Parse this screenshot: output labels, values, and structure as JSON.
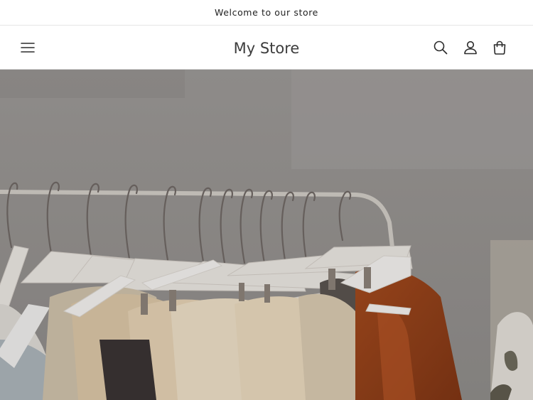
{
  "announcement": {
    "text": "Welcome to our store"
  },
  "header": {
    "logo": "My Store",
    "icons": {
      "menu": "hamburger-menu-icon",
      "search": "search-icon",
      "account": "account-icon",
      "cart": "cart-icon"
    }
  },
  "hero": {
    "image": "clothes-on-hangers-rack",
    "overlay_color": "#000000"
  },
  "colors": {
    "background": "#ffffff",
    "text": "#121212",
    "border": "#e6e6e6"
  }
}
